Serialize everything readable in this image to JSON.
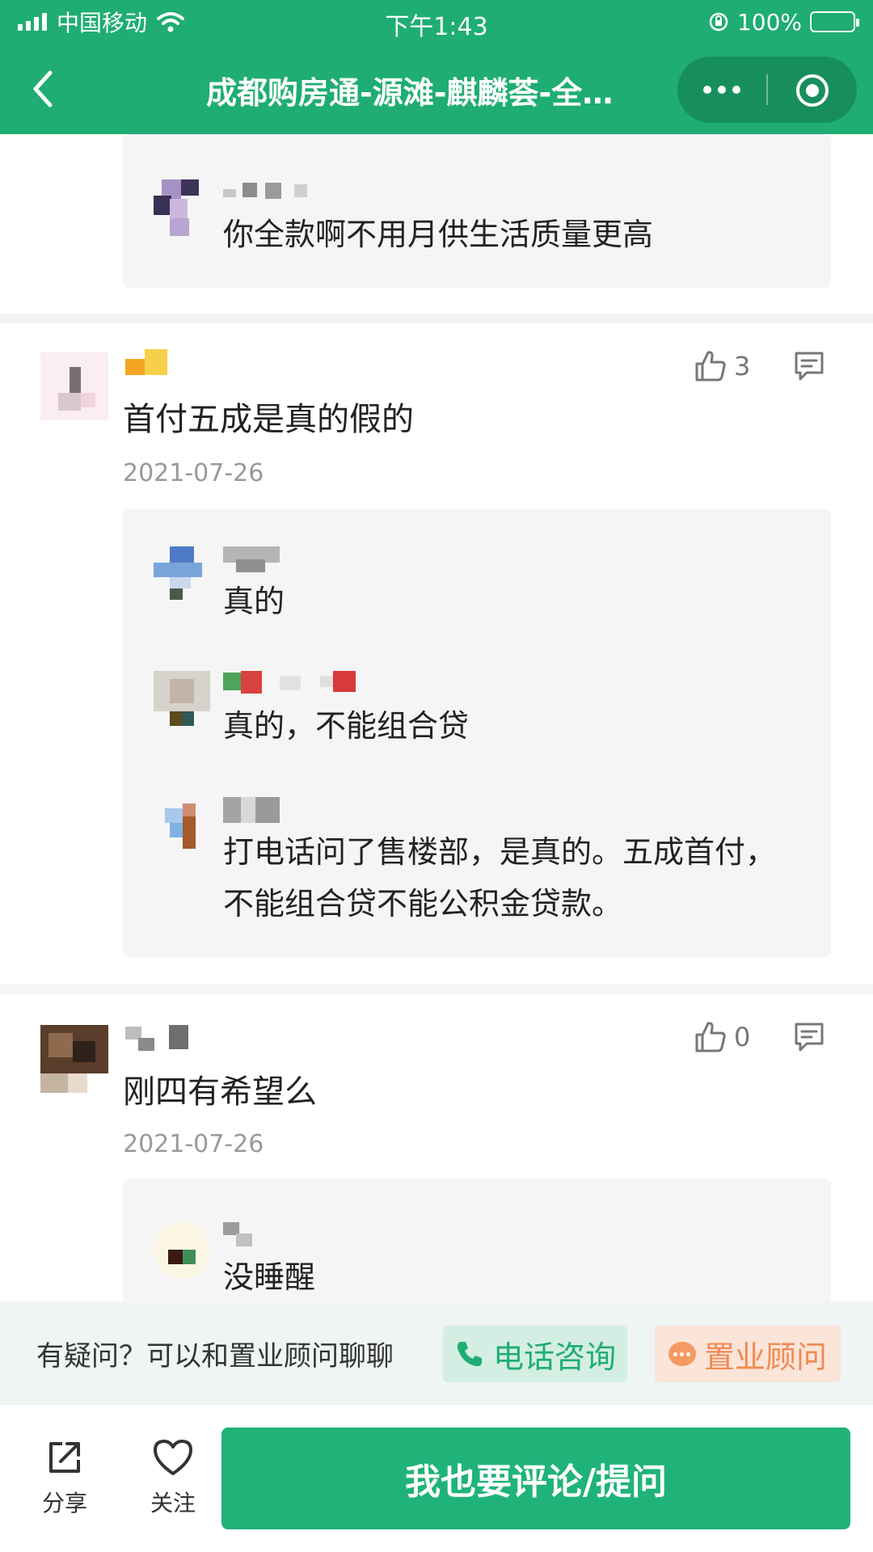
{
  "status_bar": {
    "carrier": "中国移动",
    "time": "下午1:43",
    "battery": "100%"
  },
  "nav": {
    "title": "成都购房通-源滩-麒麟荟-全…"
  },
  "comments": [
    {
      "replies": [
        {
          "text": "你全款啊不用月供生活质量更高"
        }
      ]
    },
    {
      "text": "首付五成是真的假的",
      "date": "2021-07-26",
      "likes": "3",
      "replies": [
        {
          "text": "真的"
        },
        {
          "text": "真的，不能组合贷"
        },
        {
          "text": "打电话问了售楼部，是真的。五成首付，不能组合贷不能公积金贷款。"
        }
      ]
    },
    {
      "text": "刚四有希望么",
      "date": "2021-07-26",
      "likes": "0",
      "replies": [
        {
          "text": "没睡醒"
        }
      ]
    }
  ],
  "chat_bar": {
    "prompt": "有疑问？可以和置业顾问聊聊",
    "phone_label": "电话咨询",
    "advisor_label": "置业顾问"
  },
  "bottom_bar": {
    "share_label": "分享",
    "follow_label": "关注",
    "comment_button_label": "我也要评论/提问"
  },
  "colors": {
    "brand_green": "#1fad73",
    "advisor_orange": "#f08a52"
  },
  "icons": [
    "signal-icon",
    "wifi-icon",
    "rotation-lock-icon",
    "battery-icon",
    "back-icon",
    "more-icon",
    "close-icon",
    "thumbs-up-icon",
    "comment-icon",
    "phone-icon",
    "chat-bubble-icon",
    "share-icon",
    "heart-icon"
  ]
}
